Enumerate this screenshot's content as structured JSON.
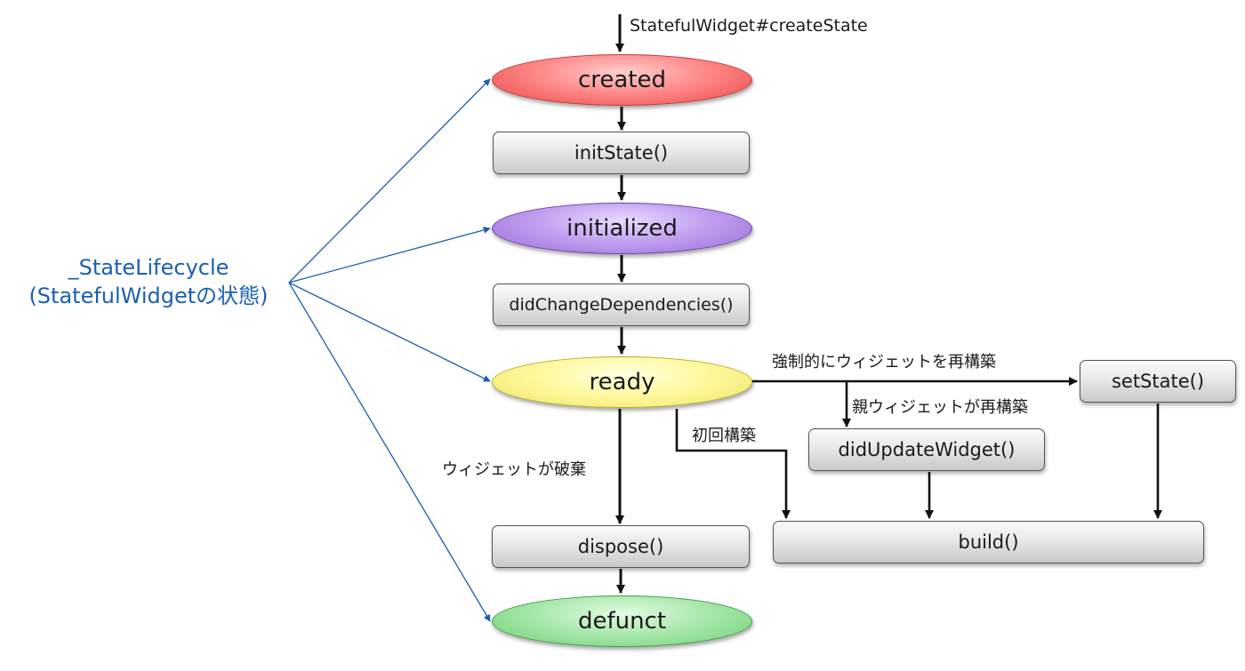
{
  "lifecycle_label": {
    "line1": "_StateLifecycle",
    "line2": "(StatefulWidgetの状態)"
  },
  "states": {
    "created": "created",
    "initialized": "initialized",
    "ready": "ready",
    "defunct": "defunct"
  },
  "methods": {
    "init_state": "initState()",
    "did_change_dependencies": "didChangeDependencies()",
    "dispose": "dispose()",
    "set_state": "setState()",
    "did_update_widget": "didUpdateWidget()",
    "build": "build()"
  },
  "transitions": {
    "create_state": "StatefulWidget#createState",
    "force_rebuild": "強制的にウィジェットを再構築",
    "parent_rebuild": "親ウィジェットが再構築",
    "first_build": "初回構築",
    "widget_disposed": "ウィジェットが破棄"
  },
  "colors": {
    "lifecycle_text": "#1a5fb4",
    "created": "#ff8a8a",
    "initialized": "#c2a1f0",
    "ready": "#fff9a0",
    "defunct": "#aae8ad",
    "method_box": "#dcdcdc"
  }
}
